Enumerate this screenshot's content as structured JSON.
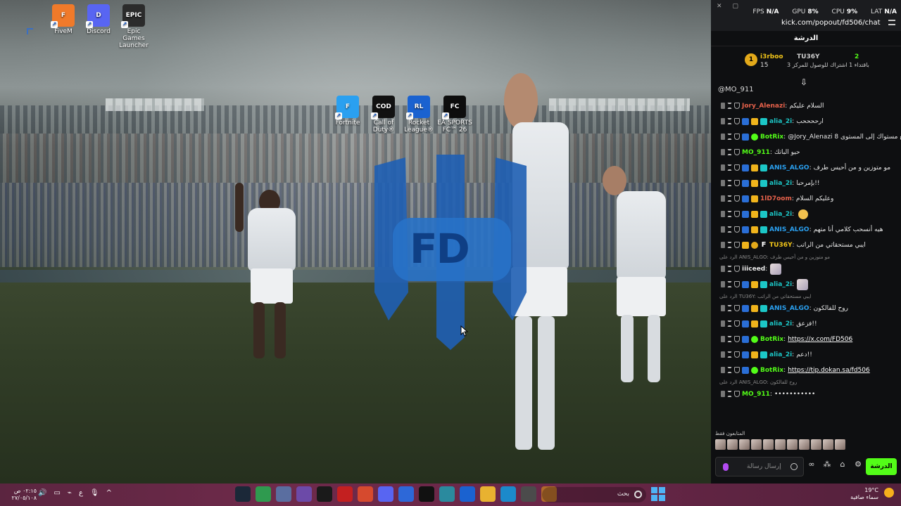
{
  "desktop": {
    "icons_top": [
      {
        "label": "FiveM",
        "color": "#f07a2a",
        "glyph": "F"
      },
      {
        "label": "Discord",
        "color": "#5865f2",
        "glyph": "D"
      },
      {
        "label": "Epic Games Launcher",
        "color": "#2b2b2b",
        "glyph": "EPIC"
      }
    ],
    "icons_center": [
      {
        "label": "Fortnite",
        "color": "#2aa0f0",
        "glyph": "F"
      },
      {
        "label": "Call of Duty®",
        "color": "#111111",
        "glyph": "COD"
      },
      {
        "label": "Rocket League®",
        "color": "#1a62d0",
        "glyph": "RL"
      },
      {
        "label": "EA SPORTS FC™ 26",
        "color": "#0d0d0d",
        "glyph": "FC"
      }
    ],
    "logo_text": "FD"
  },
  "chat": {
    "window": {
      "url": "kick.com/popout/fd506/chat",
      "tab": "kick.com/popout/fd506/chat - Google Chrome"
    },
    "hud": {
      "fps_label": "FPS",
      "fps": "N/A",
      "gpu_label": "GPU",
      "gpu": "8%",
      "cpu_label": "CPU",
      "cpu": "9%",
      "lat_label": "LAT",
      "lat": "N/A"
    },
    "title": "الدرشة",
    "leaders": {
      "first_name": "i3rboo",
      "first_count": "15",
      "second_name": "TU36Y",
      "second_sub": "باقتداء 1 اشتراك للوصول للمركز 3",
      "gift_count": "2"
    },
    "mention": "@MO_911",
    "messages": [
      {
        "user": "Jory_Alenazi",
        "color": "#e8624b",
        "text": "السلام عليكم",
        "badges": [
          "del",
          "time",
          "shield"
        ]
      },
      {
        "user": "alia_2i",
        "color": "#1cc7c7",
        "text": "ارححححب",
        "badges": [
          "del",
          "time",
          "shield",
          "mod",
          "crown",
          "vip"
        ]
      },
      {
        "user": "BotRix",
        "color": "#53fc18",
        "text": "@Jory_Alenazi قمت برفع مستواك إلى المستوى 8",
        "badges": [
          "del",
          "time",
          "shield",
          "mod",
          "bot"
        ]
      },
      {
        "user": "MO_911",
        "color": "#53fc18",
        "text": "حيو الباتك",
        "badges": [
          "del",
          "time",
          "shield"
        ]
      },
      {
        "user": "ANIS_ALGO",
        "color": "#2aa0f0",
        "text": "مو متوزين و من أحيس طرف",
        "badges": [
          "del",
          "time",
          "shield",
          "mod",
          "crown",
          "vip"
        ]
      },
      {
        "user": "alia_2i",
        "color": "#1cc7c7",
        "text": "بإمرحبا!!",
        "badges": [
          "del",
          "time",
          "shield",
          "mod",
          "crown",
          "vip"
        ]
      },
      {
        "user": "1lD7oom",
        "color": "#e8624b",
        "text": "وعليكم السلام",
        "badges": [
          "del",
          "time",
          "shield",
          "mod",
          "crown"
        ]
      },
      {
        "user": "alia_2i",
        "color": "#1cc7c7",
        "text": "",
        "badges": [
          "del",
          "time",
          "shield",
          "mod",
          "crown",
          "vip"
        ],
        "emoji": true
      },
      {
        "user": "ANIS_ALGO",
        "color": "#2aa0f0",
        "text": "هيه أنسحب كلامي أنا متهم",
        "badges": [
          "del",
          "time",
          "shield",
          "mod",
          "crown",
          "vip"
        ]
      },
      {
        "user": "TU36Y",
        "color": "#f0c419",
        "text": "ايبي مستحقاتي من الراتب",
        "badges": [
          "del",
          "time",
          "shield",
          "crown",
          "gold",
          "f"
        ]
      },
      {
        "reply": "الرد على ANIS_ALGO: مو متوزين و من أحيس طرف"
      },
      {
        "user": "iiiceed",
        "color": "#e6e6e6",
        "text": "",
        "badges": [
          "del",
          "time",
          "shield"
        ],
        "avatar": true
      },
      {
        "user": "alia_2i",
        "color": "#1cc7c7",
        "text": "",
        "badges": [
          "del",
          "time",
          "shield",
          "mod",
          "crown",
          "vip"
        ],
        "avatar": true
      },
      {
        "reply": "الرد على TU36Y: ايبي مستحقاتي من الراتب"
      },
      {
        "user": "ANIS_ALGO",
        "color": "#2aa0f0",
        "text": "روح للفالكون",
        "badges": [
          "del",
          "time",
          "shield",
          "mod",
          "crown",
          "vip"
        ]
      },
      {
        "user": "alia_2i",
        "color": "#1cc7c7",
        "text": "فزعق!!",
        "badges": [
          "del",
          "time",
          "shield",
          "mod",
          "crown",
          "vip"
        ]
      },
      {
        "user": "BotRix",
        "color": "#53fc18",
        "link": "https://x.com/FD506",
        "badges": [
          "del",
          "time",
          "shield",
          "mod",
          "bot"
        ]
      },
      {
        "user": "alia_2i",
        "color": "#1cc7c7",
        "text": "دعم!!",
        "badges": [
          "del",
          "time",
          "shield",
          "mod",
          "crown",
          "vip"
        ]
      },
      {
        "user": "BotRix",
        "color": "#53fc18",
        "link": "https://tip.dokan.sa/fd506",
        "badges": [
          "del",
          "time",
          "shield",
          "mod",
          "bot"
        ]
      },
      {
        "reply": "الرد على ANIS_ALGO: روح للفالكون"
      },
      {
        "user": "MO_911",
        "color": "#53fc18",
        "text": "•••••••••••",
        "badges": [
          "del",
          "time",
          "shield"
        ]
      }
    ],
    "followers_label": "المتابعون فقط",
    "composer_placeholder": "إرسال رسالة",
    "send_label": "الدرشة"
  },
  "taskbar": {
    "clock_time": "٠٢:١٥ ص",
    "clock_date": "٢٧/٠٥/١٠٨",
    "lang": "ع",
    "search_label": "بحث",
    "weather_temp": "19°C",
    "weather_desc": "سماء صافية",
    "apps": [
      {
        "name": "steam",
        "color": "#1b2838"
      },
      {
        "name": "app-green",
        "color": "#2f9a4f"
      },
      {
        "name": "settings",
        "color": "#5a6ea0"
      },
      {
        "name": "store",
        "color": "#6c4aa8"
      },
      {
        "name": "epic",
        "color": "#1a1a1a"
      },
      {
        "name": "rockstar",
        "color": "#c32020"
      },
      {
        "name": "chrome",
        "color": "#d64a2e"
      },
      {
        "name": "discord",
        "color": "#5865f2"
      },
      {
        "name": "app-blue",
        "color": "#2d68d8"
      },
      {
        "name": "cod",
        "color": "#111111"
      },
      {
        "name": "app-teal",
        "color": "#2a8a9e"
      },
      {
        "name": "rocket-league",
        "color": "#1a62d0"
      },
      {
        "name": "explorer",
        "color": "#e8b230"
      },
      {
        "name": "edge",
        "color": "#1b8acb"
      },
      {
        "name": "app-gray",
        "color": "#4b4b4b"
      },
      {
        "name": "game",
        "color": "#b06a2a"
      }
    ]
  }
}
